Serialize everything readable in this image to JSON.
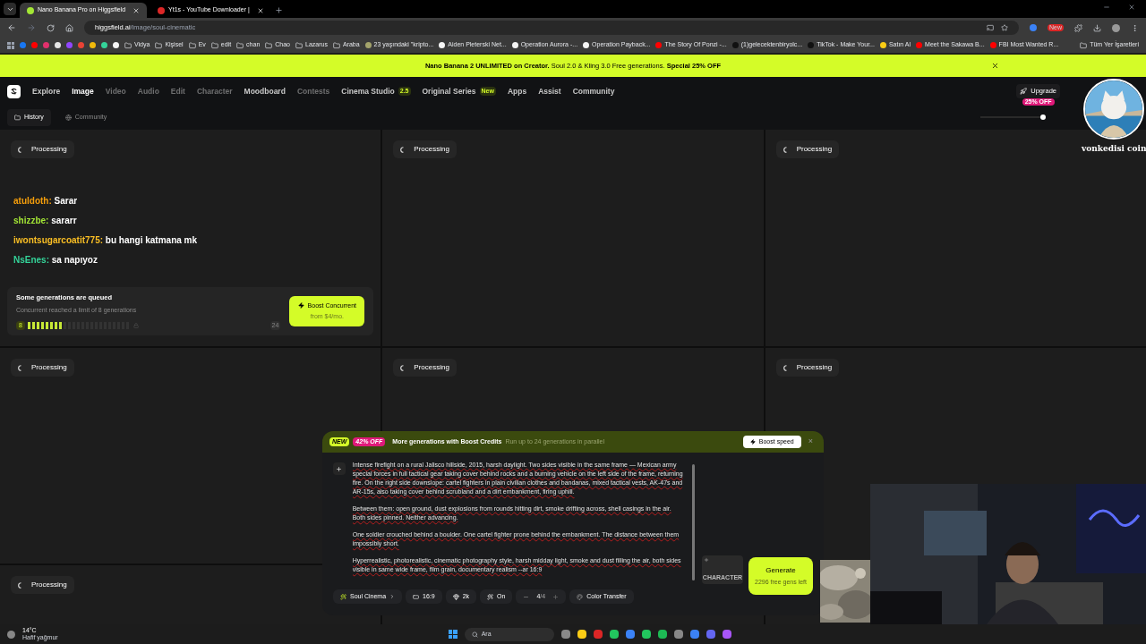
{
  "browser": {
    "tabs": [
      {
        "title": "Nano Banana Pro on Higgsfield",
        "selected": true,
        "color": "#a3e635"
      },
      {
        "title": "Yt1s - YouTube Downloader |",
        "selected": false,
        "color": "#dc2626"
      }
    ],
    "url_host": "higgsfield.ai",
    "url_path": "/image/soul-cinematic",
    "icon_bookmarks": [
      {
        "color": "#1877f2"
      },
      {
        "color": "#ff0000"
      },
      {
        "color": "#e1306c"
      },
      {
        "color": "#e5e5e5"
      },
      {
        "color": "#9146ff"
      },
      {
        "color": "#ea4335"
      },
      {
        "color": "#f0b90b"
      },
      {
        "color": "#34d399"
      },
      {
        "color": "#f5f5f5"
      }
    ],
    "bookmarks": [
      {
        "kind": "folder",
        "label": "Vidya"
      },
      {
        "kind": "folder",
        "label": "Kişisel"
      },
      {
        "kind": "folder",
        "label": "Ev"
      },
      {
        "kind": "folder",
        "label": "edit"
      },
      {
        "kind": "folder",
        "label": "chan"
      },
      {
        "kind": "folder",
        "label": "Chao"
      },
      {
        "kind": "folder",
        "label": "Lazarus"
      },
      {
        "kind": "folder",
        "label": "Araba"
      },
      {
        "kind": "site",
        "label": "23 yaşındaki \"kripto...",
        "color": "#a3a36b"
      },
      {
        "kind": "site",
        "label": "Aiden Pleterski Net...",
        "color": "#f5f5f5"
      },
      {
        "kind": "site",
        "label": "Operation Aurora -...",
        "color": "#f5f5f5"
      },
      {
        "kind": "site",
        "label": "Operation Payback...",
        "color": "#f5f5f5"
      },
      {
        "kind": "site",
        "label": "The Story Of Ponzi -...",
        "color": "#ff0000"
      },
      {
        "kind": "site",
        "label": "(1)gelecektenbiryolc...",
        "color": "#111111"
      },
      {
        "kind": "site",
        "label": "TikTok - Make Your...",
        "color": "#111111"
      },
      {
        "kind": "site",
        "label": "Satın Al",
        "color": "#facc15"
      },
      {
        "kind": "site",
        "label": "Meet the Sakawa B...",
        "color": "#ff0000"
      },
      {
        "kind": "site",
        "label": "FBI Most Wanted R...",
        "color": "#ff0000"
      }
    ],
    "all_bookmarks": "Tüm Yer İşaretleri",
    "extension_badge": "New"
  },
  "banner": {
    "text": "**Nano Banana 2 UNLIMITED on Creator.** Soul 2.0 & Kling 3.0 Free generations. **Special 25% OFF**"
  },
  "nav": {
    "items": [
      {
        "label": "Explore",
        "selected": false,
        "dimmed": false
      },
      {
        "label": "Image",
        "selected": true,
        "dimmed": false
      },
      {
        "label": "Video",
        "selected": false,
        "dimmed": true
      },
      {
        "label": "Audio",
        "selected": false,
        "dimmed": true
      },
      {
        "label": "Edit",
        "selected": false,
        "dimmed": true
      },
      {
        "label": "Character",
        "selected": false,
        "dimmed": true
      },
      {
        "label": "Moodboard",
        "selected": false,
        "dimmed": false
      },
      {
        "label": "Contests",
        "selected": false,
        "dimmed": true
      },
      {
        "label": "Cinema Studio",
        "selected": false,
        "dimmed": false,
        "badge": "2.5"
      },
      {
        "label": "Original Series",
        "selected": false,
        "dimmed": false,
        "badge": "New"
      },
      {
        "label": "Apps",
        "selected": false,
        "dimmed": false
      },
      {
        "label": "Assist",
        "selected": false,
        "dimmed": false
      },
      {
        "label": "Community",
        "selected": false,
        "dimmed": false
      }
    ],
    "upgrade": "Upgrade",
    "upgrade_badge": "25% OFF"
  },
  "subnav": [
    {
      "label": "History",
      "selected": true
    },
    {
      "label": "Community",
      "selected": false
    }
  ],
  "zoom_slider": {
    "level": 1
  },
  "cells": [
    {
      "status": "Processing"
    },
    {
      "status": "Processing"
    },
    {
      "status": "Processing"
    },
    {
      "status": "Processing"
    },
    {
      "status": "Processing"
    },
    {
      "status": "Processing"
    },
    {
      "status": "Processing"
    },
    {},
    {}
  ],
  "chat": [
    {
      "user": "atuldoth:",
      "message": "Sarar",
      "color": "#f59e0b"
    },
    {
      "user": "shizzbe:",
      "message": "sararr",
      "color": "#a3e635"
    },
    {
      "user": "iwontsugarcoatit775:",
      "message": "bu hangi katmana mk",
      "color": "#fbbf24"
    },
    {
      "user": "NsEnes:",
      "message": "sa napıyoz",
      "color": "#34d399"
    }
  ],
  "queue": {
    "title": "Some generations are queued",
    "subtitle": "Concurrent reached a limit of 8 generations",
    "count": "8",
    "max": "24",
    "level": 0.333,
    "button": "Boost Concurrent",
    "button_sub": "from $4/mo."
  },
  "promo": {
    "new_badge": "NEW",
    "discount": "42% OFF",
    "title": "More generations with Boost Credits",
    "subtitle": "Run up to 24 generations in parallel",
    "button": "Boost speed",
    "close": "×"
  },
  "prompt": {
    "paragraphs": [
      "Intense firefight on a rural Jalisco hillside, 2015, harsh daylight. Two sides visible in the same frame — Mexican army special forces in full tactical gear taking cover behind rocks and a burning vehicle on the left side of the frame, returning fire. On the right side downslope: cartel fighters in plain civilian clothes and bandanas, mixed tactical vests, AK-47s and AR-15s, also taking cover behind scrubland and a dirt embankment, firing uphill.",
      "Between them: open ground, dust explosions from rounds hitting dirt, smoke drifting across, shell casings in the air. Both sides pinned. Neither advancing.",
      "One soldier crouched behind a boulder. One cartel fighter prone behind the embankment. The distance between them impossibly short.",
      "Hyperrealistic, photorealistic, cinematic photography style, harsh midday light, smoke and dust filling the air, both sides visible in same wide frame, film grain, documentary realism --ar 16:9"
    ]
  },
  "toolbar": {
    "model": "Soul Cinema",
    "ratio": "16:9",
    "quality": "2k",
    "enhance": "On",
    "batch": "4",
    "batch_max": "/4",
    "color_transfer": "Color Transfer",
    "character": "CHARACTER",
    "generate": "Generate",
    "generate_sub": "2296 free gens left"
  },
  "overlay": {
    "avatar_caption": "vonkedisi coin"
  },
  "taskbar": {
    "temperature": "14°C",
    "weather": "Hafif yağmur",
    "search_placeholder": "Ara"
  }
}
